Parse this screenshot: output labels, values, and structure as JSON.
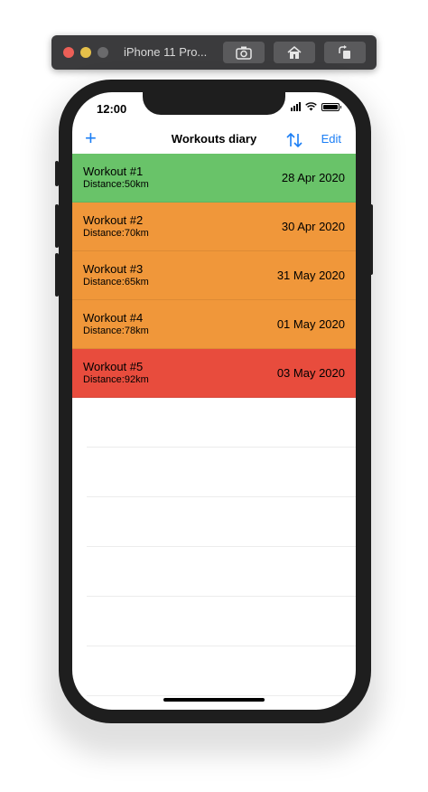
{
  "simulator": {
    "title": "iPhone 11 Pro...",
    "buttons": [
      "screenshot-icon",
      "home-icon",
      "rotate-icon"
    ]
  },
  "status_bar": {
    "time": "12:00"
  },
  "navbar": {
    "add_label": "+",
    "title": "Workouts diary",
    "edit_label": "Edit"
  },
  "workouts": [
    {
      "title": "Workout #1",
      "distance": "Distance:50km",
      "date": "28 Apr 2020",
      "color": "#69c369"
    },
    {
      "title": "Workout #2",
      "distance": "Distance:70km",
      "date": "30 Apr 2020",
      "color": "#f0973a"
    },
    {
      "title": "Workout #3",
      "distance": "Distance:65km",
      "date": "31 May 2020",
      "color": "#f0973a"
    },
    {
      "title": "Workout #4",
      "distance": "Distance:78km",
      "date": "01 May 2020",
      "color": "#f0973a"
    },
    {
      "title": "Workout #5",
      "distance": "Distance:92km",
      "date": "03 May 2020",
      "color": "#e84c3d"
    }
  ],
  "colors": {
    "accent": "#1b7ef5"
  }
}
